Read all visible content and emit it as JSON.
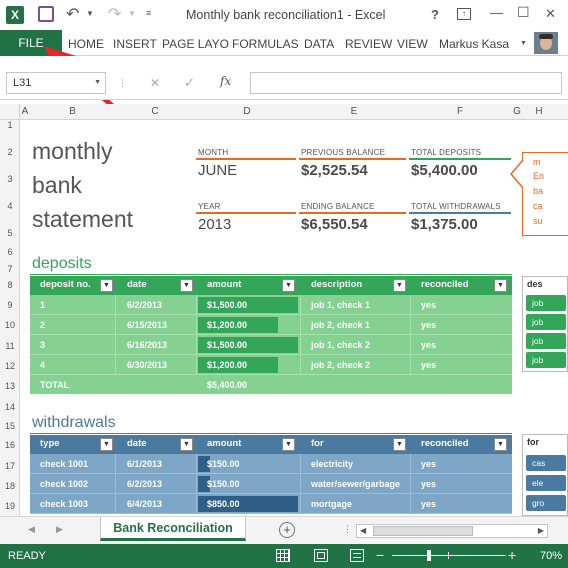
{
  "window": {
    "title": "Monthly bank reconciliation1 - Excel"
  },
  "titlebar": {
    "help": "?",
    "minimize": "—",
    "maximize": "☐",
    "close": "✕",
    "undo": "↶",
    "redo": "↷",
    "save": "💾",
    "excel_logo": "X"
  },
  "ribbon": {
    "file": "FILE",
    "tabs": [
      "HOME",
      "INSERT",
      "PAGE LAYO",
      "FORMULAS",
      "DATA",
      "REVIEW",
      "VIEW"
    ],
    "user": "Markus Kasa"
  },
  "formula_bar": {
    "name_box": "L31",
    "cancel": "✕",
    "enter": "✓",
    "fx": "fx",
    "value": ""
  },
  "columns": [
    "A",
    "B",
    "C",
    "D",
    "E",
    "F",
    "G",
    "H"
  ],
  "rows": [
    "1",
    "2",
    "3",
    "4",
    "5",
    "6",
    "7",
    "8",
    "9",
    "10",
    "11",
    "12",
    "13",
    "14",
    "15",
    "16",
    "17",
    "18",
    "19"
  ],
  "report": {
    "title_lines": [
      "monthly",
      "bank",
      "statement"
    ],
    "month_label": "MONTH",
    "month": "JUNE",
    "prev_balance_label": "PREVIOUS BALANCE",
    "prev_balance": "$2,525.54",
    "total_deposits_label": "TOTAL DEPOSITS",
    "total_deposits": "$5,400.00",
    "year_label": "YEAR",
    "year": "2013",
    "ending_balance_label": "ENDING BALANCE",
    "ending_balance": "$6,550.54",
    "total_withdrawals_label": "TOTAL WITHDRAWALS",
    "total_withdrawals": "$1,375.00",
    "callout_lines": [
      "m",
      "En",
      "ba",
      "ca",
      "su"
    ]
  },
  "deposits": {
    "heading": "deposits",
    "headers": [
      "deposit no.",
      "date",
      "amount",
      "description",
      "reconciled"
    ],
    "rows": [
      {
        "no": "1",
        "date": "6/2/2013",
        "amount": "$1,500.00",
        "description": "job 1, check 1",
        "reconciled": "yes",
        "bar": 1.0
      },
      {
        "no": "2",
        "date": "6/15/2013",
        "amount": "$1,200.00",
        "description": "job 2, check 1",
        "reconciled": "yes",
        "bar": 0.8
      },
      {
        "no": "3",
        "date": "6/16/2013",
        "amount": "$1,500.00",
        "description": "job 1, check 2",
        "reconciled": "yes",
        "bar": 1.0
      },
      {
        "no": "4",
        "date": "6/30/2013",
        "amount": "$1,200.00",
        "description": "job 2, check 2",
        "reconciled": "yes",
        "bar": 0.8
      }
    ],
    "total_label": "TOTAL",
    "total": "$5,400.00",
    "side_header": "des",
    "side_items": [
      "job",
      "job",
      "job",
      "job"
    ]
  },
  "withdrawals": {
    "heading": "withdrawals",
    "headers": [
      "type",
      "date",
      "amount",
      "for",
      "reconciled"
    ],
    "rows": [
      {
        "type": "check 1001",
        "date": "6/1/2013",
        "amount": "$150.00",
        "for": "electricity",
        "reconciled": "yes",
        "bar": 0.12
      },
      {
        "type": "check 1002",
        "date": "6/2/2013",
        "amount": "$150.00",
        "for": "water/sewer/garbage",
        "reconciled": "yes",
        "bar": 0.12
      },
      {
        "type": "check 1003",
        "date": "6/4/2013",
        "amount": "$850.00",
        "for": "mortgage",
        "reconciled": "yes",
        "bar": 1.0
      }
    ],
    "side_header": "for",
    "side_items": [
      "cas",
      "ele",
      "gro"
    ]
  },
  "sheet_tabs": {
    "active": "Bank Reconciliation",
    "add": "+"
  },
  "status": {
    "ready": "READY",
    "zoom": "70%",
    "minus": "−",
    "plus": "+"
  },
  "colors": {
    "excel_green": "#217346",
    "deposit_header": "#33a65a",
    "deposit_row": "#85d191",
    "withdraw_header": "#4a7aa0",
    "withdraw_row": "#7ea6c6",
    "orange": "#e46c1e",
    "arrow": "#e8232a"
  }
}
